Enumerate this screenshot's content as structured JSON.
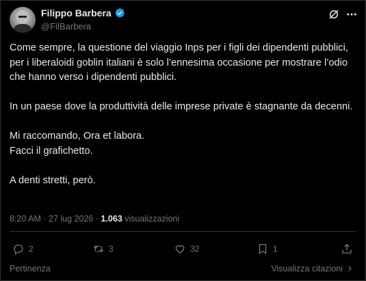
{
  "author": {
    "name": "Filippo Barbera",
    "handle": "@FilBarbera"
  },
  "post": {
    "paragraphs": [
      "Come sempre, la questione del viaggio Inps per i figli dei dipendenti pubblici,  per i liberaloidi goblin italiani è solo l’ennesima occasione per mostrare l’odio che hanno verso i dipendenti pubblici.",
      "In un paese dove la produttività delle imprese private è stagnante da decenni.",
      "Mi raccomando, Ora et labora.\nFacci il grafichetto.",
      "A denti stretti, però."
    ]
  },
  "meta": {
    "time": "8:20 AM",
    "separator": "·",
    "date": "27 lug 2026",
    "views_count": "1.063",
    "views_label": "visualizzazioni"
  },
  "actions": {
    "replies": "2",
    "reposts": "3",
    "likes": "32",
    "bookmarks": "1"
  },
  "footer": {
    "relevance": "Pertinenza",
    "quotes": "Visualizza citazioni"
  },
  "colors": {
    "background": "#000000",
    "text": "#e7e9ea",
    "muted": "#71767b",
    "verified": "#1d9bf0",
    "border": "#2f3336"
  }
}
